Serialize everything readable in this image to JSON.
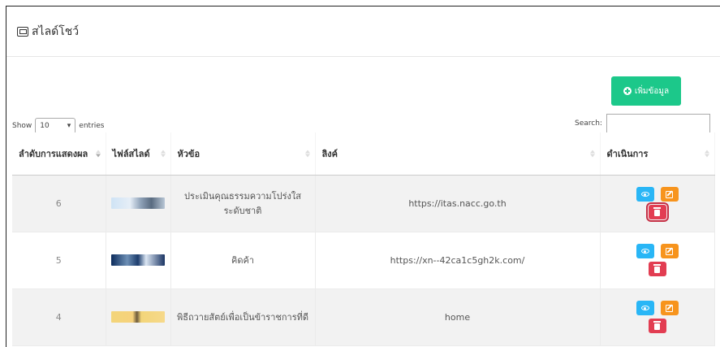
{
  "card": {
    "title": "สไลด์โชว์"
  },
  "add_button": {
    "label": "เพิ่มข้อมูล"
  },
  "length_menu": {
    "show": "Show",
    "value": "10",
    "entries": "entries"
  },
  "search": {
    "label": "Search:",
    "value": ""
  },
  "table": {
    "headers": [
      "ลำดับการแสดงผล",
      "ไฟล์สไลด์",
      "หัวข้อ",
      "ลิงค์",
      "ดำเนินการ"
    ],
    "rows": [
      {
        "order": "6",
        "title": "ประเมินคุณธรรมความโปร่งใส ระดับชาติ",
        "link": "https://itas.nacc.go.th"
      },
      {
        "order": "5",
        "title": "คิดค้า",
        "link": "https://xn--42ca1c5gh2k.com/"
      },
      {
        "order": "4",
        "title": "พิธีถวายสัตย์เพื่อเป็นข้าราชการที่ดี",
        "link": "home"
      }
    ]
  },
  "colors": {
    "add": "#1cc88a",
    "view": "#29b6f6",
    "edit": "#f7941d",
    "delete": "#e23d52"
  }
}
